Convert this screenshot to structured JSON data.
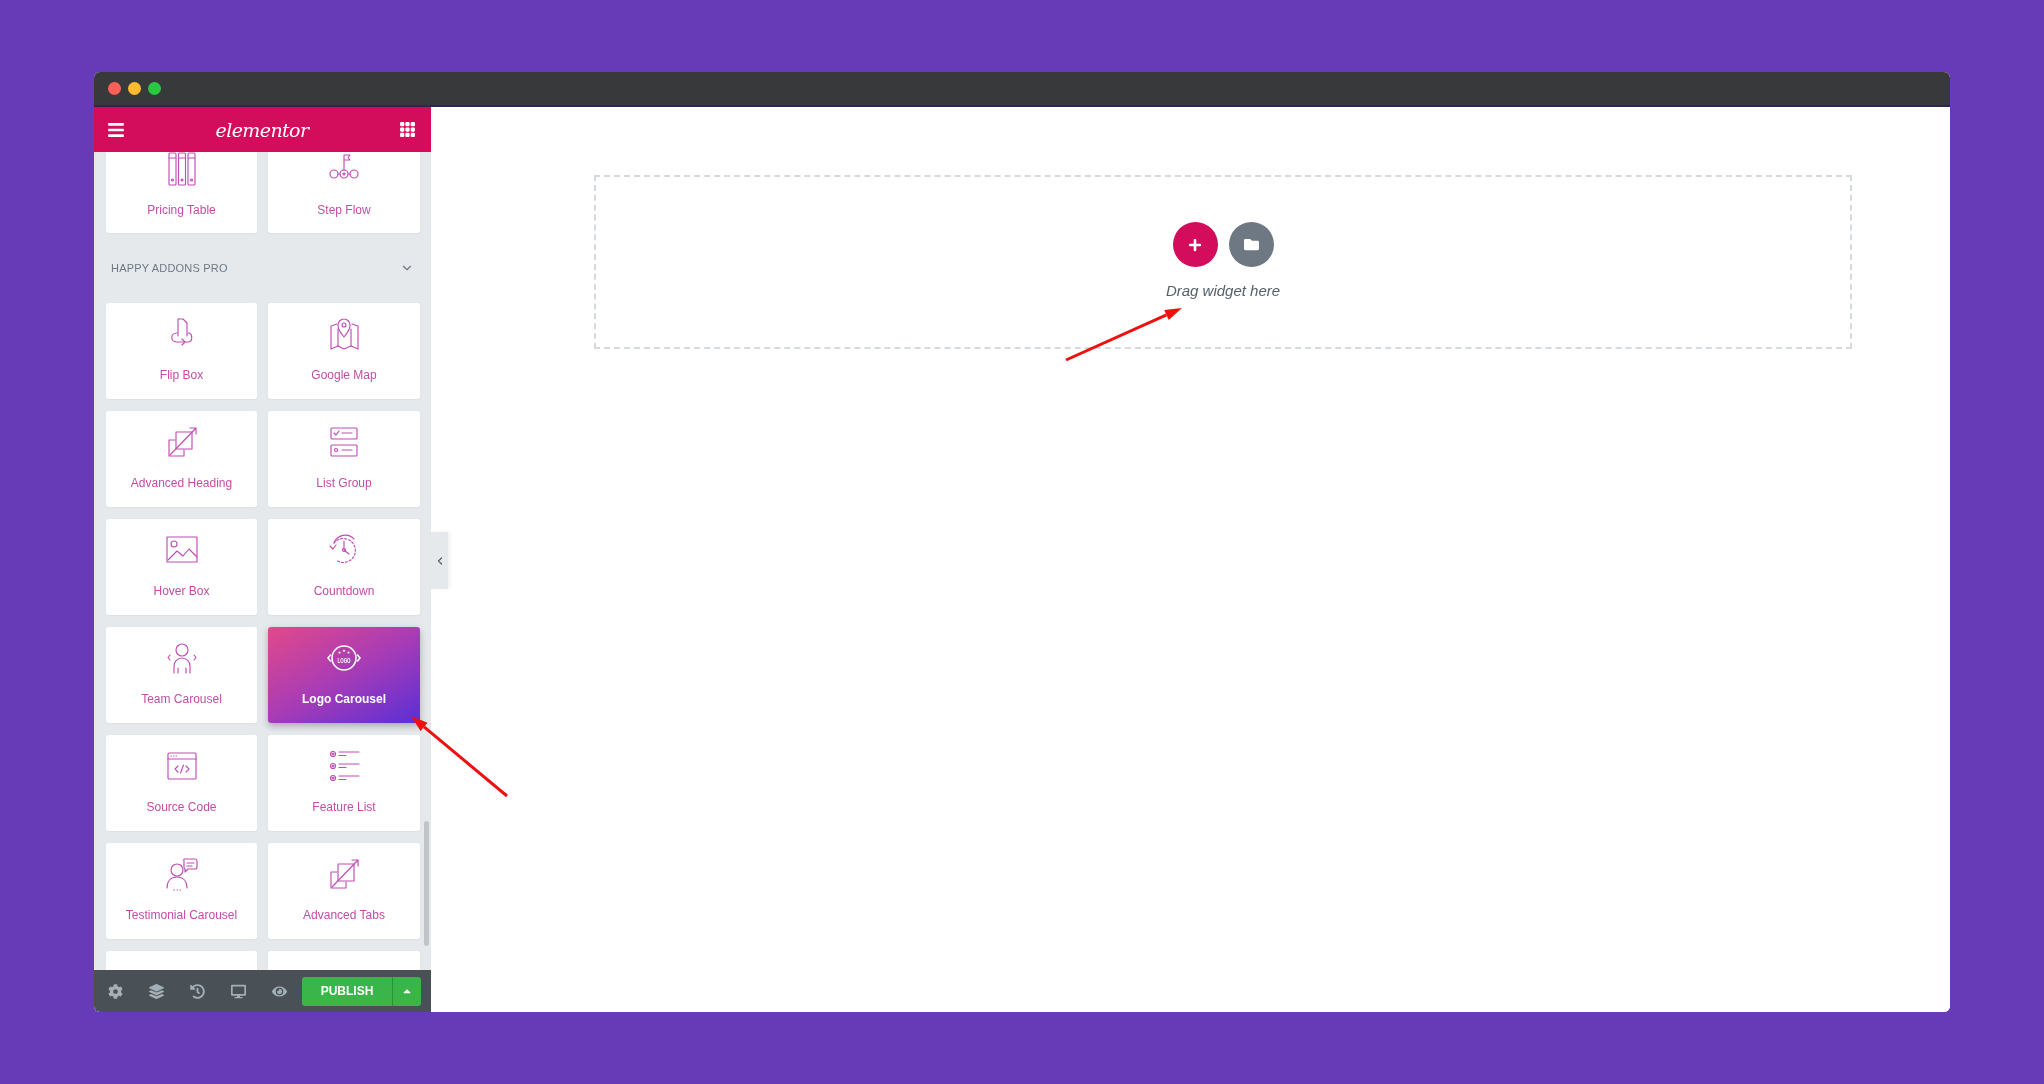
{
  "sidebar": {
    "logo": "elementor",
    "widgets_above": [
      {
        "label": "Pricing Table",
        "selected": false
      },
      {
        "label": "Step Flow",
        "selected": false
      }
    ],
    "section": {
      "title": "HAPPY ADDONS PRO",
      "expanded": true
    },
    "widgets": [
      {
        "label": "Flip Box",
        "selected": false
      },
      {
        "label": "Google Map",
        "selected": false
      },
      {
        "label": "Advanced Heading",
        "selected": false
      },
      {
        "label": "List Group",
        "selected": false
      },
      {
        "label": "Hover Box",
        "selected": false
      },
      {
        "label": "Countdown",
        "selected": false
      },
      {
        "label": "Team Carousel",
        "selected": false
      },
      {
        "label": "Logo Carousel",
        "selected": true
      },
      {
        "label": "Source Code",
        "selected": false
      },
      {
        "label": "Feature List",
        "selected": false
      },
      {
        "label": "Testimonial Carousel",
        "selected": false
      },
      {
        "label": "Advanced Tabs",
        "selected": false
      }
    ],
    "badge_text": "LOGO"
  },
  "footer": {
    "publish_label": "PUBLISH"
  },
  "canvas": {
    "drop_hint": "Drag widget here"
  }
}
